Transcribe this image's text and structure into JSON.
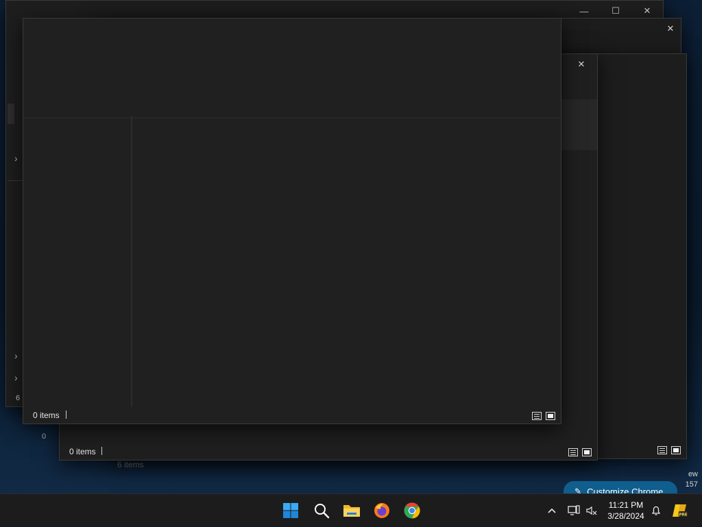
{
  "windows": {
    "front": {
      "status_items": "0 items"
    },
    "middle": {
      "status_items": "0 items"
    },
    "back": {
      "status_items": "6 items",
      "edge_digit_1": "0",
      "edge_digit_2": "6"
    }
  },
  "window_controls": {
    "minimize": "—",
    "maximize": "☐",
    "close": "✕"
  },
  "desktop_edge_text": {
    "line1": "ew",
    "line2": "157"
  },
  "customize_chrome": {
    "label": "Customize Chrome",
    "icon": "pencil-icon"
  },
  "taskbar": {
    "apps": [
      {
        "name": "Start",
        "icon": "windows-logo-icon"
      },
      {
        "name": "Search",
        "icon": "search-icon"
      },
      {
        "name": "File Explorer",
        "icon": "folder-icon"
      },
      {
        "name": "Firefox",
        "icon": "firefox-icon"
      },
      {
        "name": "Chrome",
        "icon": "chrome-icon"
      }
    ],
    "tray": {
      "chevron": "^",
      "clock_time": "11:21 PM",
      "clock_date": "3/28/2024"
    }
  },
  "colors": {
    "taskbar_bg": "#1c1c1c",
    "window_bg": "#202020",
    "accent": "#0f5e8d"
  }
}
